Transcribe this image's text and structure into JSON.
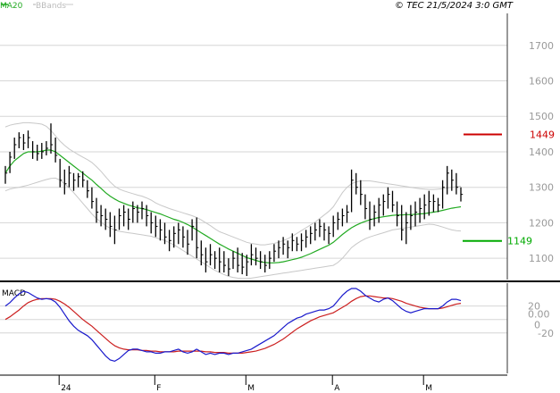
{
  "header": {
    "legend_ma": "MA20",
    "legend_bb": "BBands",
    "copyright": "© TEC 21/5/2024 3:0 GMT",
    "macd_label": "MACD"
  },
  "colors": {
    "ma20": "#22aa22",
    "bbands": "#c8c8c8",
    "price": "#000000",
    "macd_line": "#1a1acc",
    "signal_line": "#cc2020",
    "resistance": "#cc0000",
    "support": "#00aa00",
    "grid": "#d6d6d6"
  },
  "chart_data": [
    {
      "type": "ohlc",
      "name": "price",
      "y_axis": {
        "range": [
          1040,
          1790
        ],
        "ticks": [
          "1100",
          "1200",
          "1300",
          "1400",
          "1500",
          "1600",
          "1700"
        ],
        "grid": true
      },
      "x_axis": {
        "labels": [
          "24",
          "F",
          "M",
          "A",
          "M"
        ],
        "label_bars": [
          12,
          33,
          53,
          72,
          92
        ]
      },
      "bars": [
        {
          "h": 1360,
          "l": 1310,
          "c": 1340
        },
        {
          "h": 1400,
          "l": 1340,
          "c": 1385
        },
        {
          "h": 1440,
          "l": 1380,
          "c": 1420
        },
        {
          "h": 1455,
          "l": 1410,
          "c": 1440
        },
        {
          "h": 1450,
          "l": 1405,
          "c": 1425
        },
        {
          "h": 1460,
          "l": 1410,
          "c": 1440
        },
        {
          "h": 1430,
          "l": 1380,
          "c": 1400
        },
        {
          "h": 1420,
          "l": 1375,
          "c": 1395
        },
        {
          "h": 1425,
          "l": 1380,
          "c": 1400
        },
        {
          "h": 1430,
          "l": 1390,
          "c": 1410
        },
        {
          "h": 1480,
          "l": 1395,
          "c": 1420
        },
        {
          "h": 1440,
          "l": 1370,
          "c": 1390
        },
        {
          "h": 1380,
          "l": 1300,
          "c": 1320
        },
        {
          "h": 1350,
          "l": 1280,
          "c": 1310
        },
        {
          "h": 1360,
          "l": 1300,
          "c": 1340
        },
        {
          "h": 1340,
          "l": 1290,
          "c": 1320
        },
        {
          "h": 1340,
          "l": 1300,
          "c": 1330
        },
        {
          "h": 1345,
          "l": 1300,
          "c": 1320
        },
        {
          "h": 1320,
          "l": 1270,
          "c": 1290
        },
        {
          "h": 1300,
          "l": 1240,
          "c": 1260
        },
        {
          "h": 1270,
          "l": 1200,
          "c": 1230
        },
        {
          "h": 1250,
          "l": 1190,
          "c": 1220
        },
        {
          "h": 1240,
          "l": 1180,
          "c": 1210
        },
        {
          "h": 1230,
          "l": 1160,
          "c": 1190
        },
        {
          "h": 1220,
          "l": 1140,
          "c": 1180
        },
        {
          "h": 1240,
          "l": 1180,
          "c": 1220
        },
        {
          "h": 1250,
          "l": 1190,
          "c": 1230
        },
        {
          "h": 1240,
          "l": 1180,
          "c": 1210
        },
        {
          "h": 1260,
          "l": 1200,
          "c": 1240
        },
        {
          "h": 1250,
          "l": 1200,
          "c": 1230
        },
        {
          "h": 1260,
          "l": 1210,
          "c": 1240
        },
        {
          "h": 1250,
          "l": 1190,
          "c": 1220
        },
        {
          "h": 1230,
          "l": 1170,
          "c": 1200
        },
        {
          "h": 1220,
          "l": 1160,
          "c": 1190
        },
        {
          "h": 1210,
          "l": 1150,
          "c": 1180
        },
        {
          "h": 1200,
          "l": 1140,
          "c": 1160
        },
        {
          "h": 1180,
          "l": 1120,
          "c": 1150
        },
        {
          "h": 1190,
          "l": 1130,
          "c": 1170
        },
        {
          "h": 1200,
          "l": 1140,
          "c": 1180
        },
        {
          "h": 1190,
          "l": 1130,
          "c": 1160
        },
        {
          "h": 1180,
          "l": 1110,
          "c": 1140
        },
        {
          "h": 1210,
          "l": 1150,
          "c": 1190
        },
        {
          "h": 1215,
          "l": 1100,
          "c": 1130
        },
        {
          "h": 1150,
          "l": 1080,
          "c": 1110
        },
        {
          "h": 1130,
          "l": 1060,
          "c": 1090
        },
        {
          "h": 1140,
          "l": 1080,
          "c": 1110
        },
        {
          "h": 1120,
          "l": 1070,
          "c": 1100
        },
        {
          "h": 1130,
          "l": 1060,
          "c": 1090
        },
        {
          "h": 1120,
          "l": 1060,
          "c": 1080
        },
        {
          "h": 1100,
          "l": 1050,
          "c": 1070
        },
        {
          "h": 1120,
          "l": 1070,
          "c": 1100
        },
        {
          "h": 1130,
          "l": 1060,
          "c": 1080
        },
        {
          "h": 1115,
          "l": 1055,
          "c": 1075
        },
        {
          "h": 1110,
          "l": 1050,
          "c": 1090
        },
        {
          "h": 1140,
          "l": 1080,
          "c": 1110
        },
        {
          "h": 1130,
          "l": 1080,
          "c": 1100
        },
        {
          "h": 1120,
          "l": 1070,
          "c": 1090
        },
        {
          "h": 1110,
          "l": 1060,
          "c": 1080
        },
        {
          "h": 1120,
          "l": 1070,
          "c": 1100
        },
        {
          "h": 1140,
          "l": 1090,
          "c": 1120
        },
        {
          "h": 1150,
          "l": 1100,
          "c": 1130
        },
        {
          "h": 1160,
          "l": 1110,
          "c": 1140
        },
        {
          "h": 1150,
          "l": 1100,
          "c": 1130
        },
        {
          "h": 1170,
          "l": 1120,
          "c": 1150
        },
        {
          "h": 1160,
          "l": 1120,
          "c": 1140
        },
        {
          "h": 1170,
          "l": 1120,
          "c": 1150
        },
        {
          "h": 1180,
          "l": 1130,
          "c": 1160
        },
        {
          "h": 1190,
          "l": 1140,
          "c": 1170
        },
        {
          "h": 1200,
          "l": 1150,
          "c": 1180
        },
        {
          "h": 1210,
          "l": 1160,
          "c": 1190
        },
        {
          "h": 1200,
          "l": 1150,
          "c": 1180
        },
        {
          "h": 1190,
          "l": 1140,
          "c": 1170
        },
        {
          "h": 1220,
          "l": 1160,
          "c": 1200
        },
        {
          "h": 1230,
          "l": 1180,
          "c": 1210
        },
        {
          "h": 1240,
          "l": 1190,
          "c": 1220
        },
        {
          "h": 1250,
          "l": 1200,
          "c": 1230
        },
        {
          "h": 1350,
          "l": 1230,
          "c": 1320
        },
        {
          "h": 1340,
          "l": 1280,
          "c": 1300
        },
        {
          "h": 1320,
          "l": 1250,
          "c": 1280
        },
        {
          "h": 1280,
          "l": 1210,
          "c": 1240
        },
        {
          "h": 1260,
          "l": 1180,
          "c": 1210
        },
        {
          "h": 1250,
          "l": 1190,
          "c": 1230
        },
        {
          "h": 1270,
          "l": 1200,
          "c": 1250
        },
        {
          "h": 1280,
          "l": 1220,
          "c": 1260
        },
        {
          "h": 1300,
          "l": 1240,
          "c": 1280
        },
        {
          "h": 1290,
          "l": 1230,
          "c": 1250
        },
        {
          "h": 1260,
          "l": 1190,
          "c": 1220
        },
        {
          "h": 1250,
          "l": 1150,
          "c": 1180
        },
        {
          "h": 1230,
          "l": 1140,
          "c": 1200
        },
        {
          "h": 1250,
          "l": 1180,
          "c": 1220
        },
        {
          "h": 1260,
          "l": 1190,
          "c": 1230
        },
        {
          "h": 1270,
          "l": 1200,
          "c": 1240
        },
        {
          "h": 1280,
          "l": 1210,
          "c": 1250
        },
        {
          "h": 1290,
          "l": 1220,
          "c": 1260
        },
        {
          "h": 1280,
          "l": 1230,
          "c": 1260
        },
        {
          "h": 1270,
          "l": 1230,
          "c": 1250
        },
        {
          "h": 1320,
          "l": 1240,
          "c": 1300
        },
        {
          "h": 1360,
          "l": 1280,
          "c": 1340
        },
        {
          "h": 1350,
          "l": 1290,
          "c": 1320
        },
        {
          "h": 1340,
          "l": 1280,
          "c": 1300
        },
        {
          "h": 1300,
          "l": 1260,
          "c": 1280
        }
      ],
      "ma20": [
        1340,
        1360,
        1375,
        1385,
        1395,
        1400,
        1400,
        1400,
        1402,
        1405,
        1405,
        1400,
        1390,
        1380,
        1370,
        1360,
        1350,
        1340,
        1330,
        1320,
        1308,
        1297,
        1285,
        1275,
        1267,
        1260,
        1255,
        1250,
        1246,
        1242,
        1240,
        1237,
        1233,
        1229,
        1225,
        1220,
        1215,
        1210,
        1206,
        1201,
        1195,
        1188,
        1180,
        1172,
        1164,
        1156,
        1148,
        1140,
        1133,
        1126,
        1120,
        1114,
        1108,
        1102,
        1098,
        1094,
        1090,
        1088,
        1087,
        1087,
        1088,
        1090,
        1093,
        1096,
        1099,
        1103,
        1108,
        1113,
        1119,
        1125,
        1131,
        1137,
        1145,
        1156,
        1167,
        1177,
        1186,
        1193,
        1199,
        1204,
        1208,
        1212,
        1215,
        1217,
        1219,
        1221,
        1222,
        1222,
        1223,
        1223,
        1224,
        1225,
        1226,
        1228,
        1230,
        1232,
        1235,
        1238,
        1241,
        1243,
        1245
      ],
      "bb_upper": [
        1470,
        1475,
        1478,
        1480,
        1482,
        1482,
        1481,
        1480,
        1478,
        1472,
        1460,
        1445,
        1430,
        1418,
        1408,
        1400,
        1392,
        1385,
        1378,
        1370,
        1358,
        1345,
        1330,
        1315,
        1303,
        1295,
        1290,
        1286,
        1282,
        1278,
        1275,
        1270,
        1264,
        1256,
        1250,
        1245,
        1240,
        1236,
        1232,
        1228,
        1224,
        1220,
        1215,
        1208,
        1200,
        1192,
        1183,
        1175,
        1170,
        1165,
        1160,
        1155,
        1150,
        1145,
        1142,
        1140,
        1138,
        1138,
        1140,
        1142,
        1145,
        1150,
        1155,
        1162,
        1170,
        1178,
        1186,
        1194,
        1202,
        1212,
        1222,
        1232,
        1245,
        1265,
        1285,
        1300,
        1310,
        1315,
        1318,
        1318,
        1318,
        1316,
        1314,
        1312,
        1310,
        1308,
        1306,
        1304,
        1302,
        1300,
        1298,
        1296,
        1295,
        1294,
        1294,
        1295,
        1296,
        1298,
        1300,
        1302,
        1303
      ],
      "bb_lower": [
        1290,
        1295,
        1298,
        1300,
        1303,
        1306,
        1310,
        1314,
        1318,
        1322,
        1325,
        1326,
        1320,
        1310,
        1298,
        1285,
        1270,
        1255,
        1240,
        1225,
        1212,
        1202,
        1192,
        1185,
        1180,
        1176,
        1174,
        1172,
        1170,
        1168,
        1166,
        1164,
        1162,
        1158,
        1154,
        1150,
        1144,
        1138,
        1130,
        1122,
        1114,
        1106,
        1098,
        1090,
        1082,
        1074,
        1066,
        1060,
        1054,
        1049,
        1046,
        1044,
        1043,
        1043,
        1044,
        1046,
        1048,
        1050,
        1052,
        1054,
        1056,
        1058,
        1060,
        1062,
        1064,
        1066,
        1068,
        1070,
        1072,
        1074,
        1076,
        1078,
        1080,
        1088,
        1100,
        1115,
        1130,
        1140,
        1148,
        1155,
        1160,
        1164,
        1168,
        1172,
        1176,
        1180,
        1182,
        1184,
        1186,
        1188,
        1190,
        1192,
        1194,
        1196,
        1195,
        1192,
        1188,
        1184,
        1180,
        1178,
        1177
      ],
      "levels": [
        {
          "value": 1449,
          "label": "1449",
          "color": "#cc0000"
        },
        {
          "value": 1149,
          "label": "1149",
          "color": "#00aa00"
        }
      ]
    },
    {
      "type": "line",
      "name": "MACD",
      "y_axis": {
        "range": [
          -80,
          50
        ],
        "ticks": [
          "20",
          "0.00",
          "0",
          "-20"
        ]
      },
      "series": [
        {
          "name": "MACD",
          "values": [
            20,
            25,
            32,
            38,
            42,
            40,
            36,
            32,
            30,
            31,
            30,
            26,
            18,
            8,
            -2,
            -10,
            -16,
            -20,
            -24,
            -30,
            -38,
            -46,
            -54,
            -60,
            -62,
            -58,
            -52,
            -46,
            -44,
            -44,
            -46,
            -48,
            -48,
            -50,
            -50,
            -48,
            -48,
            -46,
            -44,
            -48,
            -50,
            -48,
            -44,
            -48,
            -52,
            -50,
            -52,
            -50,
            -50,
            -52,
            -50,
            -50,
            -48,
            -46,
            -44,
            -40,
            -36,
            -32,
            -28,
            -24,
            -18,
            -12,
            -6,
            -2,
            2,
            4,
            8,
            10,
            12,
            14,
            14,
            16,
            20,
            28,
            36,
            42,
            46,
            46,
            42,
            36,
            32,
            28,
            26,
            30,
            32,
            28,
            22,
            16,
            12,
            10,
            12,
            14,
            16,
            16,
            16,
            16,
            20,
            26,
            30,
            30,
            28
          ]
        },
        {
          "name": "Signal",
          "values": [
            0,
            4,
            9,
            14,
            20,
            25,
            28,
            30,
            31,
            31,
            31,
            30,
            27,
            23,
            18,
            12,
            6,
            0,
            -5,
            -10,
            -16,
            -22,
            -28,
            -34,
            -39,
            -42,
            -44,
            -45,
            -45,
            -45,
            -46,
            -46,
            -47,
            -47,
            -48,
            -48,
            -48,
            -48,
            -47,
            -47,
            -47,
            -47,
            -47,
            -47,
            -48,
            -48,
            -49,
            -49,
            -49,
            -50,
            -50,
            -50,
            -50,
            -49,
            -48,
            -47,
            -45,
            -43,
            -40,
            -37,
            -33,
            -29,
            -24,
            -19,
            -14,
            -10,
            -6,
            -2,
            1,
            4,
            6,
            8,
            10,
            14,
            18,
            22,
            27,
            31,
            34,
            35,
            35,
            34,
            33,
            32,
            32,
            31,
            29,
            27,
            24,
            22,
            20,
            18,
            17,
            16,
            16,
            16,
            17,
            19,
            21,
            23,
            24
          ]
        }
      ]
    }
  ]
}
